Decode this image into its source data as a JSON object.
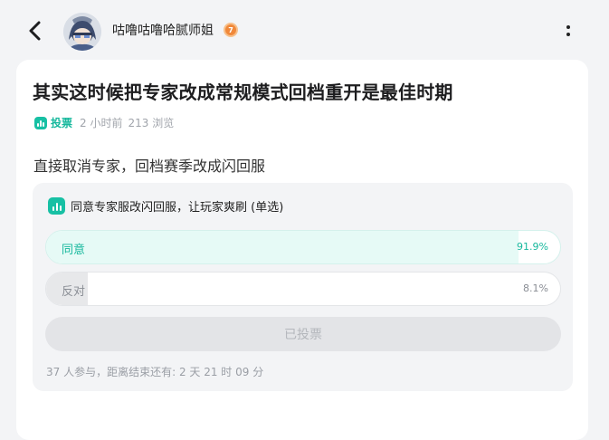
{
  "header": {
    "username": "咕噜咕噜哈腻师姐",
    "level_badge": "7",
    "icons": {
      "back": "chevron-left-icon",
      "more": "more-vertical-icon"
    }
  },
  "post": {
    "title": "其实这时候把专家改成常规模式回档重开是最佳时期",
    "tag": "投票",
    "time": "2 小时前",
    "views": "213 浏览",
    "body": "直接取消专家，回档赛季改成闪回服"
  },
  "poll": {
    "question": "同意专家服改闪回服，让玩家爽刷 (单选)",
    "options": [
      {
        "label": "同意",
        "percent_text": "91.9%",
        "fraction": 0.919
      },
      {
        "label": "反对",
        "percent_text": "8.1%",
        "fraction": 0.081
      }
    ],
    "voted_button": "已投票",
    "footer": "37 人参与，距离结束还有: 2 天 21 时 09 分"
  },
  "colors": {
    "accent": "#17c0a4",
    "accent_text": "#17b89d",
    "page_bg": "#f3f4f6",
    "poll_bg": "#f3f4f6"
  }
}
